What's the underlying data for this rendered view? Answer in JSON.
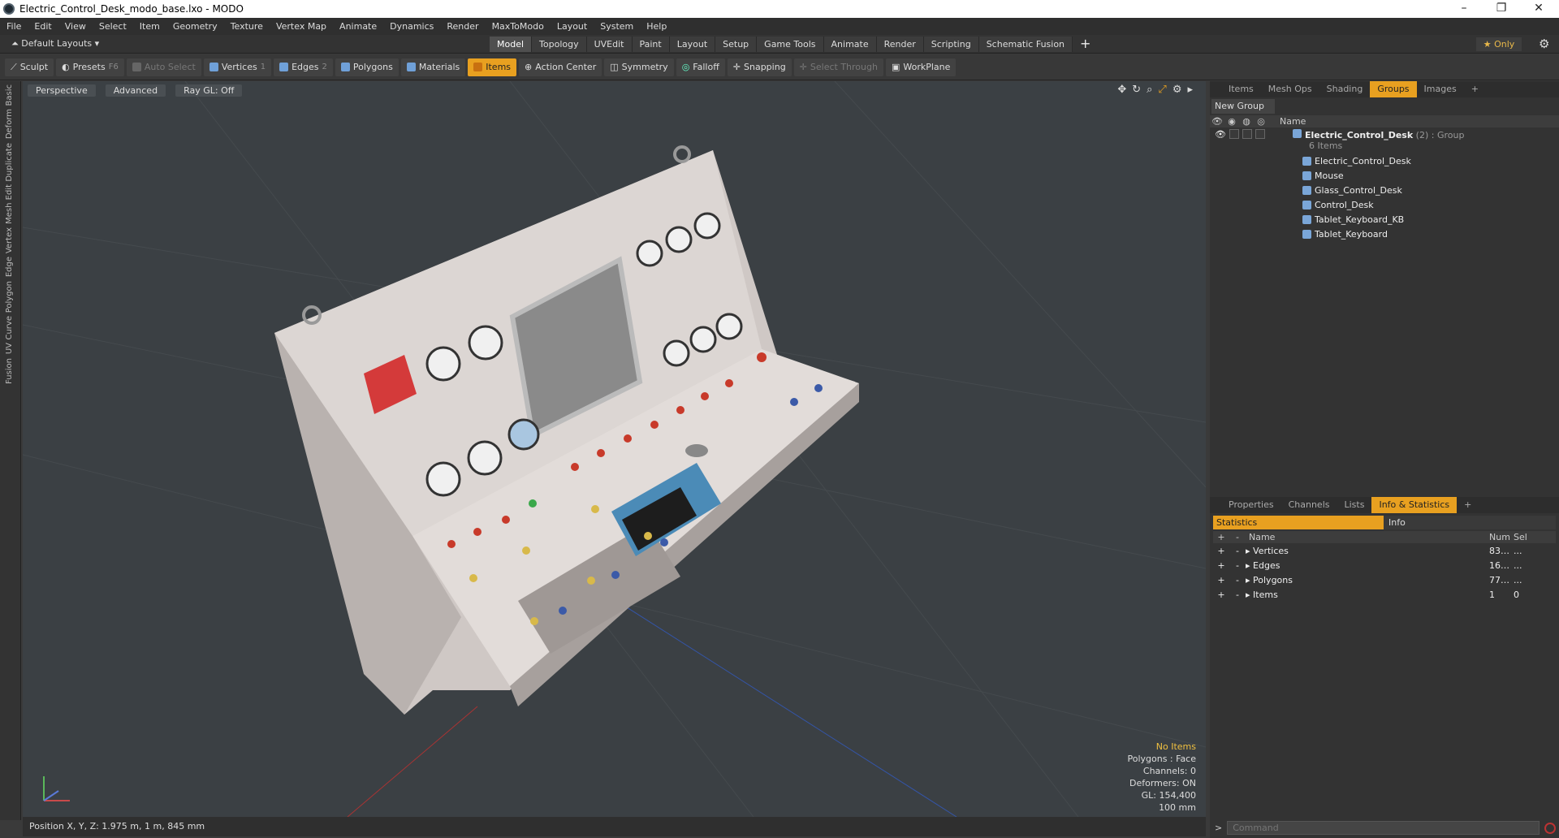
{
  "window": {
    "title": "Electric_Control_Desk_modo_base.lxo - MODO"
  },
  "menu": [
    "File",
    "Edit",
    "View",
    "Select",
    "Item",
    "Geometry",
    "Texture",
    "Vertex Map",
    "Animate",
    "Dynamics",
    "Render",
    "MaxToModo",
    "Layout",
    "System",
    "Help"
  ],
  "layouts_label": "Default Layouts",
  "layout_tabs": [
    {
      "label": "Model",
      "active": true
    },
    {
      "label": "Topology"
    },
    {
      "label": "UVEdit"
    },
    {
      "label": "Paint"
    },
    {
      "label": "Layout"
    },
    {
      "label": "Setup"
    },
    {
      "label": "Game Tools"
    },
    {
      "label": "Animate"
    },
    {
      "label": "Render"
    },
    {
      "label": "Scripting"
    },
    {
      "label": "Schematic Fusion"
    }
  ],
  "only_label": "Only",
  "toolbar": [
    {
      "label": "Sculpt"
    },
    {
      "label": "Presets",
      "key": "F6"
    },
    {
      "label": "Auto Select",
      "dim": true
    },
    {
      "label": "Vertices",
      "key": "1"
    },
    {
      "label": "Edges",
      "key": "2"
    },
    {
      "label": "Polygons"
    },
    {
      "label": "Materials"
    },
    {
      "label": "Items",
      "active": true
    },
    {
      "label": "Action Center"
    },
    {
      "label": "Symmetry"
    },
    {
      "label": "Falloff"
    },
    {
      "label": "Snapping"
    },
    {
      "label": "Select Through",
      "dim": true
    },
    {
      "label": "WorkPlane"
    }
  ],
  "left_tabs": [
    "Basic",
    "Deform",
    "Duplicate",
    "Mesh Edit",
    "Vertex",
    "Edge",
    "Polygon",
    "Curve",
    "UV",
    "Fusion"
  ],
  "viewport": {
    "view_mode": "Perspective",
    "shading": "Advanced",
    "raygl": "Ray GL: Off",
    "info": {
      "no_items": "No Items",
      "polygons": "Polygons : Face",
      "channels": "Channels: 0",
      "deformers": "Deformers: ON",
      "gl": "GL: 154,400",
      "unit": "100 mm"
    }
  },
  "status": {
    "position": "Position X, Y, Z:  1.975 m, 1 m, 845 mm"
  },
  "scene_tabs": [
    {
      "label": "Items"
    },
    {
      "label": "Mesh Ops"
    },
    {
      "label": "Shading"
    },
    {
      "label": "Groups",
      "active": true
    },
    {
      "label": "Images"
    }
  ],
  "groups": {
    "new_group": "New Group",
    "col_name": "Name",
    "group_name": "Electric_Control_Desk",
    "group_suffix": "(2) : Group",
    "group_count": "6 Items",
    "children": [
      "Electric_Control_Desk",
      "Mouse",
      "Glass_Control_Desk",
      "Control_Desk",
      "Tablet_Keyboard_KB",
      "Tablet_Keyboard"
    ]
  },
  "prop_tabs": [
    {
      "label": "Properties"
    },
    {
      "label": "Channels"
    },
    {
      "label": "Lists"
    },
    {
      "label": "Info & Statistics",
      "active": true
    }
  ],
  "stats": {
    "tab_statistics": "Statistics",
    "tab_info": "Info",
    "col_name": "Name",
    "col_num": "Num",
    "col_sel": "Sel",
    "rows": [
      {
        "name": "Vertices",
        "num": "83…",
        "sel": "..."
      },
      {
        "name": "Edges",
        "num": "16…",
        "sel": "..."
      },
      {
        "name": "Polygons",
        "num": "77…",
        "sel": "..."
      },
      {
        "name": "Items",
        "num": "1",
        "sel": "0"
      }
    ]
  },
  "command": {
    "placeholder": "Command"
  },
  "colors": {
    "accent": "#e8a020",
    "viewport_bg": "#3b4044",
    "panel_bg": "#333333",
    "desk": "#d8d2cf"
  }
}
